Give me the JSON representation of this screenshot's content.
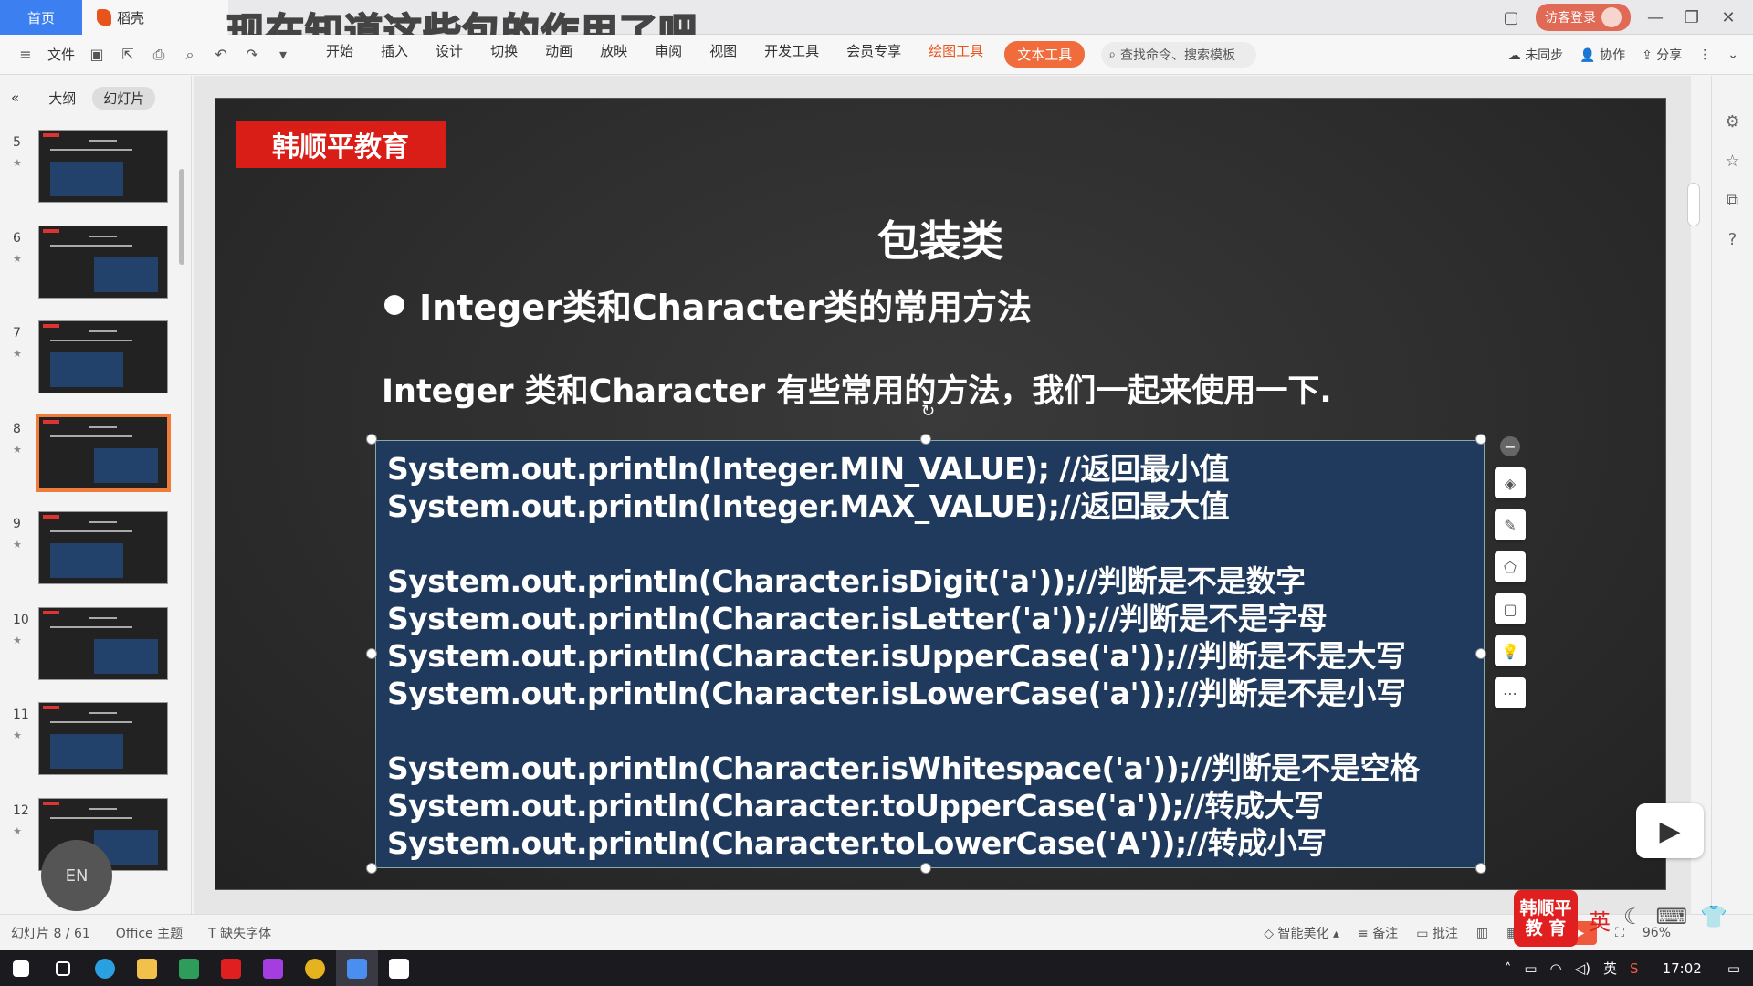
{
  "overlay_caption": "现在知道这些包的作用了吧",
  "tabs": {
    "home": "首页",
    "doc": "稻壳"
  },
  "window": {
    "guest_login": "访客登录"
  },
  "toolbar": {
    "file": "文件",
    "menu": [
      "开始",
      "插入",
      "设计",
      "切换",
      "动画",
      "放映",
      "审阅",
      "视图",
      "开发工具",
      "会员专享"
    ],
    "draw_tool": "绘图工具",
    "text_tool": "文本工具",
    "search_placeholder": "查找命令、搜索模板",
    "not_synced": "未同步",
    "collaborate": "协作",
    "share": "分享"
  },
  "sidepanel": {
    "outline": "大纲",
    "slides": "幻灯片",
    "thumbnails": [
      "5",
      "6",
      "7",
      "8",
      "9",
      "10",
      "11",
      "12"
    ],
    "selected": "8"
  },
  "slide": {
    "brand": "韩顺平教育",
    "title": "包装类",
    "bullet": "Integer类和Character类的常用方法",
    "intro": "Integer 类和Character 有些常用的方法，我们一起来使用一下.",
    "code": [
      "System.out.println(Integer.MIN_VALUE); //返回最小值",
      "System.out.println(Integer.MAX_VALUE);//返回最大值",
      "",
      "System.out.println(Character.isDigit('a'));//判断是不是数字",
      "System.out.println(Character.isLetter('a'));//判断是不是字母",
      "System.out.println(Character.isUpperCase('a'));//判断是不是大写",
      "System.out.println(Character.isLowerCase('a'));//判断是不是小写",
      "",
      "System.out.println(Character.isWhitespace('a'));//判断是不是空格",
      "System.out.println(Character.toUpperCase('a'));//转成大写",
      "System.out.println(Character.toLowerCase('A'));//转成小写"
    ]
  },
  "status": {
    "slide_count": "幻灯片 8 / 61",
    "theme": "Office 主题",
    "missing_font": "缺失字体",
    "beautify": "智能美化",
    "notes": "备注",
    "comments": "批注",
    "zoom": "96%"
  },
  "badge": {
    "line1": "韩顺平",
    "line2": "教 育"
  },
  "ime": {
    "lang": "英"
  },
  "taskbar": {
    "ime_lang": "英",
    "time": "17:02"
  },
  "colors": {
    "accent": "#f06c3c",
    "brand_red": "#d91e18",
    "code_bg": "#1f3a5c"
  }
}
